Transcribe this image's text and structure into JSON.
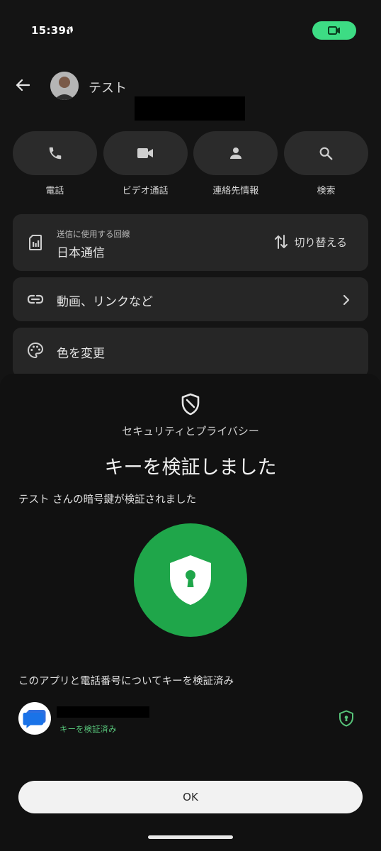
{
  "status_bar": {
    "time": "15:39",
    "call_pill_color": "#3ddc84"
  },
  "header": {
    "contact_name": "テスト"
  },
  "actions": [
    {
      "label": "電話",
      "icon": "phone-icon"
    },
    {
      "label": "ビデオ通話",
      "icon": "video-icon"
    },
    {
      "label": "連絡先情報",
      "icon": "person-icon"
    },
    {
      "label": "検索",
      "icon": "search-icon"
    }
  ],
  "sim_card": {
    "sub_label": "送信に使用する回線",
    "carrier": "日本通信",
    "switch_label": "切り替える"
  },
  "media_card": {
    "label": "動画、リンクなど"
  },
  "color_card": {
    "label": "色を変更"
  },
  "sheet": {
    "caption": "セキュリティとプライバシー",
    "title": "キーを検証しました",
    "description": "テスト さんの暗号鍵が検証されました",
    "verified_heading": "このアプリと電話番号についてキーを検証済み",
    "verified_status": "キーを検証済み",
    "ok_label": "OK",
    "accent_color": "#1fa64a",
    "status_color": "#57c57a"
  }
}
